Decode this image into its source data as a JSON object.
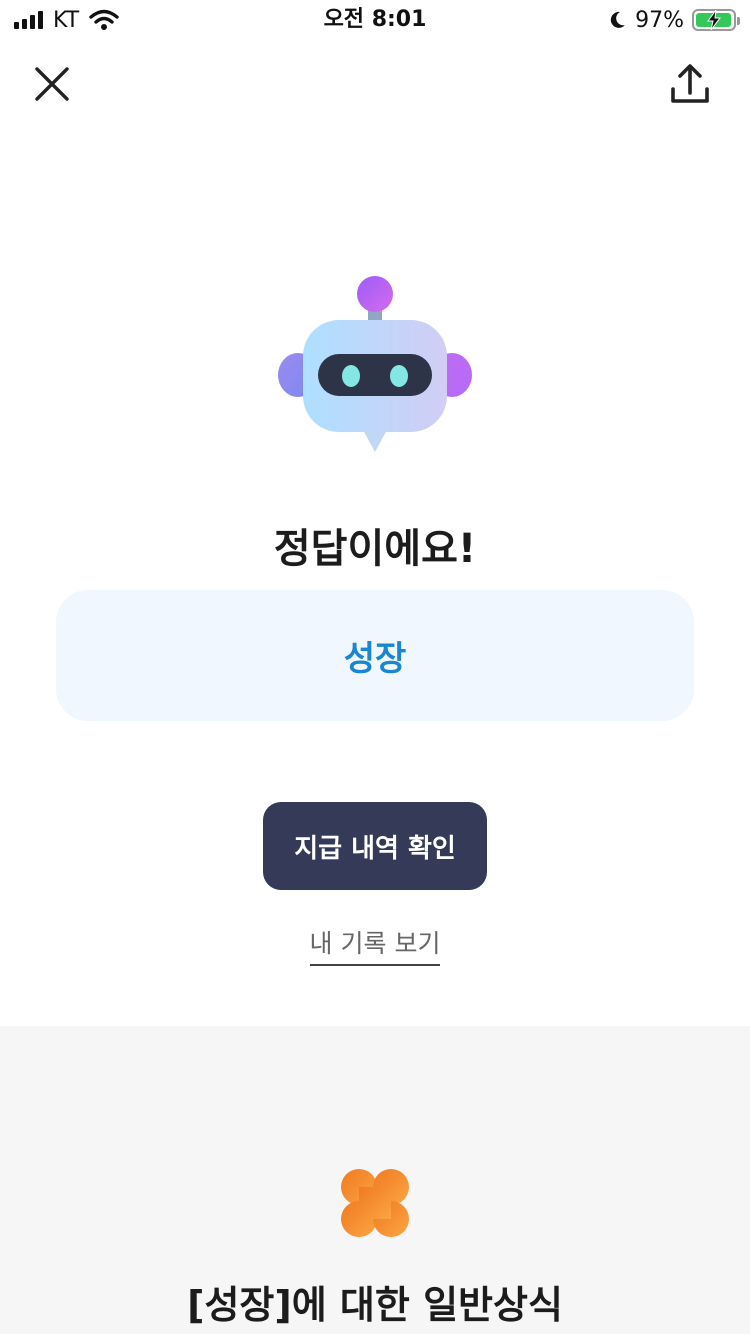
{
  "status_bar": {
    "carrier": "KT",
    "time": "오전 8:01",
    "battery_percent": "97%",
    "battery_level": 0.97
  },
  "nav": {
    "close_icon": "close-icon",
    "share_icon": "share-icon"
  },
  "result": {
    "title": "정답이에요!",
    "answer": "성장"
  },
  "actions": {
    "history_button": "지급 내역 확인",
    "records_link": "내 기록 보기"
  },
  "section": {
    "title": "[성장]에 대한 일반상식",
    "icon": "clover-icon"
  },
  "colors": {
    "accent_blue": "#1a86d0",
    "button_dark": "#343a58",
    "clover_orange": "#f39432",
    "battery_green": "#34c759"
  }
}
